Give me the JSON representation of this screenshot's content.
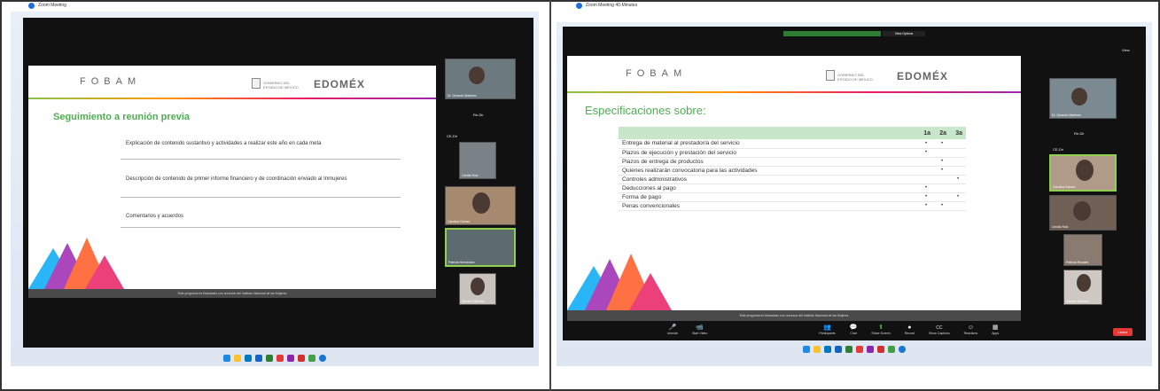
{
  "left": {
    "title": "Zoom Meeting",
    "slide": {
      "logo": "FOBAM",
      "gov_text": "GOBIERNO DEL ESTADO DE MÉXICO",
      "brand": "EDOMÉX",
      "title": "Seguimiento a reunión previa",
      "bullets": [
        "Explicación de contenido sustantivo y actividades a realizar este año en cada meta",
        "Descripción de contenido de primer informe financiero y de coordinación enviado al Inmujeres",
        "Comentarios y acuerdos"
      ],
      "footer": "Este programa es financiado con recursos del Instituto Nacional de las Mujeres"
    },
    "participants": [
      {
        "name": "Dr. Gerardo Martínez",
        "tag": ""
      },
      {
        "name": "Cecilia Ruiz",
        "tag": ""
      },
      {
        "name": "Carolina Gómez",
        "tag": ""
      },
      {
        "name": "Patricia Hernández",
        "tag": ""
      },
      {
        "name": "Sandra Sánchez",
        "tag": ""
      }
    ],
    "side_labels": [
      "Re-Dir",
      "CE-Dir"
    ]
  },
  "right": {
    "title": "Zoom Meeting 40-Minutes",
    "view_options": "View Options",
    "view_label": "View",
    "slide": {
      "logo": "FOBAM",
      "gov_text": "GOBIERNO DEL ESTADO DE MÉXICO",
      "brand": "EDOMÉX",
      "title": "Especificaciones sobre:",
      "columns": [
        "1a",
        "2a",
        "3a"
      ],
      "rows": [
        {
          "label": "Entrega de material al prestador/a del servicio",
          "marks": [
            "•",
            "•",
            ""
          ]
        },
        {
          "label": "Plazos de ejecución y prestación del servicio",
          "marks": [
            "•",
            "",
            ""
          ]
        },
        {
          "label": "Plazos de entrega de productos",
          "marks": [
            "",
            "•",
            ""
          ]
        },
        {
          "label": "Quienes realizarán convocatoria para las actividades",
          "marks": [
            "",
            "•",
            ""
          ]
        },
        {
          "label": "Controles administrativos",
          "marks": [
            "",
            "",
            "•"
          ]
        },
        {
          "label": "Deducciones al pago",
          "marks": [
            "•",
            "",
            ""
          ]
        },
        {
          "label": "Forma de pago",
          "marks": [
            "•",
            "",
            "•"
          ]
        },
        {
          "label": "Penas convencionales",
          "marks": [
            "•",
            "•",
            ""
          ]
        }
      ],
      "footer": "Este programa es financiado con recursos del Instituto Nacional de las Mujeres"
    },
    "participants": [
      {
        "name": "Dr. Gerardo Martínez"
      },
      {
        "name": "Carolina Gómez"
      },
      {
        "name": "Cecilia Ruiz"
      },
      {
        "name": "Patricia Rosales"
      },
      {
        "name": "Sandra Sánchez"
      }
    ],
    "side_labels": [
      "Re-Dir",
      "CE-Dir"
    ],
    "toolbar": [
      {
        "label": "Unmute",
        "icon": "🎤"
      },
      {
        "label": "Start Video",
        "icon": "📹"
      },
      {
        "label": "Participants",
        "icon": "👥"
      },
      {
        "label": "Chat",
        "icon": "💬"
      },
      {
        "label": "Share Screen",
        "icon": "⬆"
      },
      {
        "label": "Record",
        "icon": "●"
      },
      {
        "label": "Show Captions",
        "icon": "CC"
      },
      {
        "label": "Reactions",
        "icon": "☺"
      },
      {
        "label": "Apps",
        "icon": "▦"
      }
    ],
    "end_label": "Leave"
  }
}
